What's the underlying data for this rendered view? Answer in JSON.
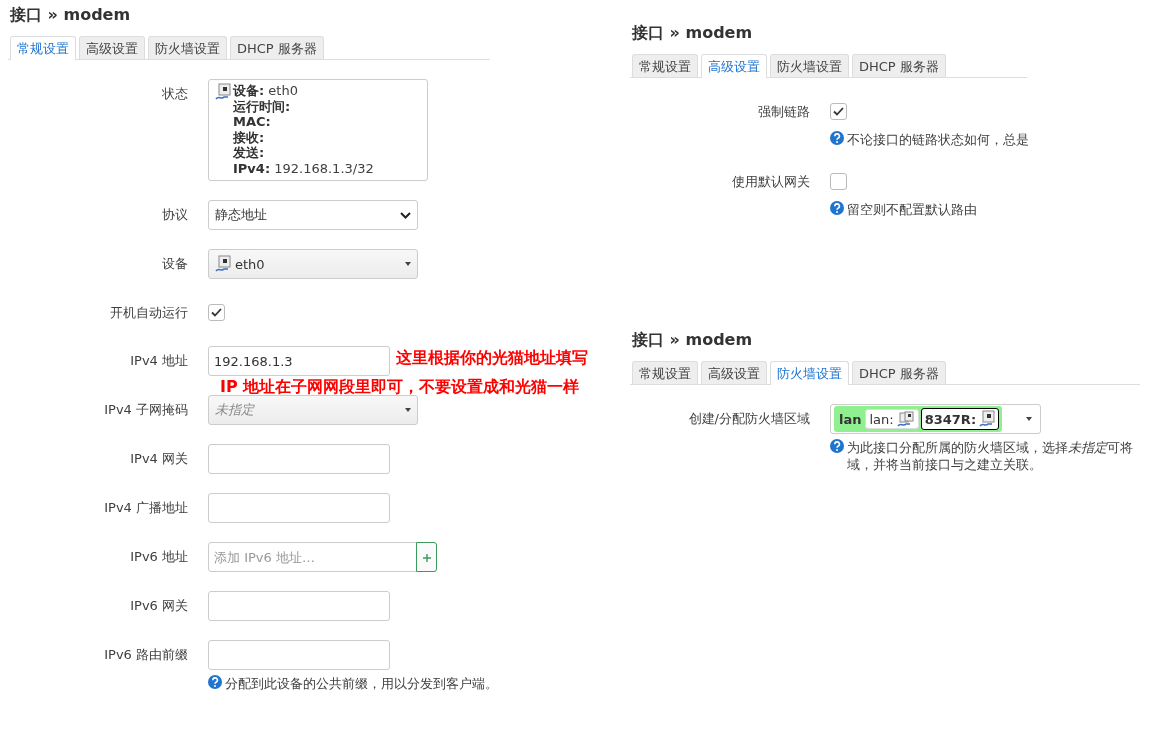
{
  "panels": [
    {
      "title": "接口 » modem",
      "tabs": [
        {
          "label": "常规设置",
          "selected": true
        },
        {
          "label": "高级设置",
          "selected": false
        },
        {
          "label": "防火墙设置",
          "selected": false
        },
        {
          "label": "DHCP 服务器",
          "selected": false
        }
      ],
      "rows": [
        {
          "kind": "status",
          "label": "状态",
          "lines": [
            {
              "label": "设备:",
              "value": "eth0"
            },
            {
              "label": "运行时间:"
            },
            {
              "label": "MAC:"
            },
            {
              "label": "接收:"
            },
            {
              "label": "发送:"
            },
            {
              "label": "IPv4:",
              "value": "192.168.1.3/32"
            }
          ]
        },
        {
          "kind": "select",
          "label": "协议",
          "value": "静态地址"
        },
        {
          "kind": "device",
          "label": "设备",
          "value": "eth0"
        },
        {
          "kind": "checkbox",
          "label": "开机自动运行",
          "checked": true
        },
        {
          "kind": "text",
          "label": "IPv4 地址",
          "value": "192.168.1.3"
        },
        {
          "kind": "combo",
          "label": "IPv4 子网掩码",
          "placeholder": "未指定"
        },
        {
          "kind": "text",
          "label": "IPv4 网关"
        },
        {
          "kind": "text",
          "label": "IPv4 广播地址"
        },
        {
          "kind": "list",
          "label": "IPv6 地址",
          "placeholder": "添加 IPv6 地址…"
        },
        {
          "kind": "text",
          "label": "IPv6 网关"
        },
        {
          "kind": "text",
          "label": "IPv6 路由前缀",
          "help": [
            "分配到此设备的公共前缀，用以分发到客户端。"
          ]
        }
      ],
      "annotation": [
        "这里根据你的光猫地址填写",
        "IP 地址在子网网段里即可，不要设置成和光猫一样"
      ]
    },
    {
      "title": "接口 » modem",
      "tabs": [
        {
          "label": "常规设置",
          "selected": false
        },
        {
          "label": "高级设置",
          "selected": true
        },
        {
          "label": "防火墙设置",
          "selected": false
        },
        {
          "label": "DHCP 服务器",
          "selected": false
        }
      ],
      "rows": [
        {
          "kind": "checkbox",
          "label": "强制链路",
          "checked": true,
          "help": [
            "不论接口的链路状态如何，总是"
          ]
        },
        {
          "kind": "checkbox",
          "label": "使用默认网关",
          "checked": false,
          "help": [
            "留空则不配置默认路由"
          ]
        }
      ]
    },
    {
      "title": "接口 » modem",
      "tabs": [
        {
          "label": "常规设置",
          "selected": false
        },
        {
          "label": "高级设置",
          "selected": false
        },
        {
          "label": "防火墙设置",
          "selected": true
        },
        {
          "label": "DHCP 服务器",
          "selected": false
        }
      ],
      "rows": [
        {
          "kind": "zone",
          "label": "创建/分配防火墙区域",
          "zone": "lan",
          "members": [
            {
              "label": "lan:",
              "selected": false
            },
            {
              "label": "8347R:",
              "selected": true
            }
          ],
          "help": [
            {
              "before": "为此接口分配所属的防火墙区域，选择",
              "em": "未指定",
              "after": "可将"
            },
            "域，并将当前接口与之建立关联。"
          ]
        }
      ]
    }
  ]
}
